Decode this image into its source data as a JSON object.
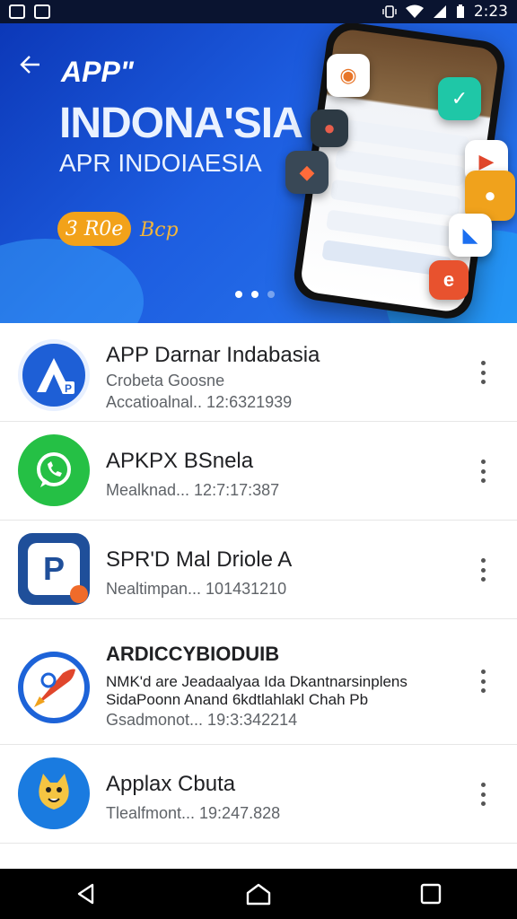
{
  "status_bar": {
    "time": "2:23"
  },
  "banner": {
    "title_small": "APP\"",
    "title_big": "INDONA'SIA",
    "subtitle": "APR INDOIAESIA",
    "pill_label": "3 R0e",
    "pill_side": "Bcp",
    "accent": "#f2a21a",
    "carousel_dots": 3,
    "active_dot": 0
  },
  "apps": [
    {
      "name": "APP Darnar Indabasia",
      "line1": "Crobeta Goosne",
      "line2": "Accatioalnal.. 12:6321939",
      "icon": "letter-a-icon",
      "color": "#1e5fd6"
    },
    {
      "name": "APKPX BSnela",
      "line1": "Mealknad... 12:7:17:387",
      "icon": "whatsapp-icon",
      "color": "#25c045"
    },
    {
      "name": "SPR'D Mal Driole A",
      "line1": "Nealtimpan... 101431210",
      "icon": "letter-p-icon",
      "color": "#1f4f9a"
    },
    {
      "name": "ARDICCYBIODUIB",
      "desc1": "NMK'd are Jeadaalyaa Ida Dkantnarsinplens",
      "desc2": "SidaPoonn Anand 6kdtlahlakl Chah Pb",
      "line1": "Gsadmonot... 19:3:342214",
      "icon": "rocket-icon",
      "color": "#1d63d8"
    },
    {
      "name": "Applax Cbuta",
      "line1": "Tlealfmont... 19:247.828",
      "icon": "mascot-icon",
      "color": "#1a7be0"
    }
  ]
}
